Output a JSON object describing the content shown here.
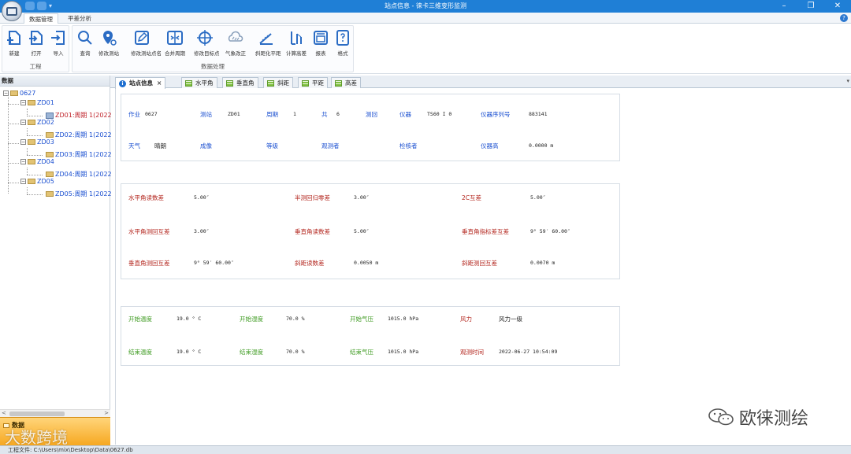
{
  "window": {
    "title": "站点信息 - 徕卡三维变形监测",
    "minimize": "–",
    "maximize": "❐",
    "close": "✕"
  },
  "ribbon_tabs": [
    "数据管理",
    "平差分析"
  ],
  "help": "?",
  "ribbon": {
    "groups": [
      {
        "label": "工程",
        "buttons": [
          "新建",
          "打开",
          "导入"
        ]
      },
      {
        "label": "数据处理",
        "buttons": [
          "查询",
          "修改测站",
          "修改测站点名",
          "合并周期",
          "修改目标点",
          "气象改正",
          "斜距化平距",
          "计算高差",
          "报表",
          "格式"
        ]
      }
    ]
  },
  "left_panel": {
    "header": "数据",
    "root": "0627",
    "stations": [
      {
        "name": "ZD01",
        "child": "ZD01:周期 1(2022"
      },
      {
        "name": "ZD02",
        "child": "ZD02:周期 1(2022"
      },
      {
        "name": "ZD03",
        "child": "ZD03:周期 1(2022"
      },
      {
        "name": "ZD04",
        "child": "ZD04:周期 1(2022"
      },
      {
        "name": "ZD05",
        "child": "ZD05:周期 1(2022"
      }
    ],
    "bottom_tab": "数据",
    "scroll_left": "<",
    "scroll_right": ">"
  },
  "doc_tabs": {
    "active": "站点信息",
    "close": "×",
    "others": [
      "水平角",
      "垂直角",
      "斜距",
      "平距",
      "高差"
    ],
    "dropdown": "▾"
  },
  "station_info": {
    "row1": [
      {
        "label": "作业",
        "value": "0627"
      },
      {
        "label": "测站",
        "value": "ZD01"
      },
      {
        "label": "周期",
        "value": "1"
      },
      {
        "label": "共",
        "value": "6"
      },
      {
        "label": "测回",
        "value": ""
      },
      {
        "label": "仪器",
        "value": "TS60 I 0"
      },
      {
        "label": "仪器序列号",
        "value": "883141"
      }
    ],
    "row2": [
      {
        "label": "天气",
        "value": "晴朗"
      },
      {
        "label": "成像",
        "value": ""
      },
      {
        "label": "等级",
        "value": ""
      },
      {
        "label": "观测者",
        "value": ""
      },
      {
        "label": "检核者",
        "value": ""
      },
      {
        "label": "仪器高",
        "value": "0.0000 m"
      }
    ]
  },
  "tolerances": [
    [
      {
        "label": "水平角读数差",
        "value": "5.00″"
      },
      {
        "label": "半测回归零差",
        "value": "3.00″"
      },
      {
        "label": "2C互差",
        "value": "5.00″"
      }
    ],
    [
      {
        "label": "水平角测回互差",
        "value": "3.00″"
      },
      {
        "label": "垂直角读数差",
        "value": "5.00″"
      },
      {
        "label": "垂直角指标差互差",
        "value": "9° 59′ 60.00″"
      }
    ],
    [
      {
        "label": "垂直角测回互差",
        "value": "9° 59′ 60.00″"
      },
      {
        "label": "斜距读数差",
        "value": "0.0050 m"
      },
      {
        "label": "斜距测回互差",
        "value": "0.0070 m"
      }
    ]
  ],
  "weather": [
    [
      {
        "label": "开始温度",
        "value": "19.0 ° C"
      },
      {
        "label": "开始湿度",
        "value": "70.0 %"
      },
      {
        "label": "开始气压",
        "value": "1015.0 hPa"
      },
      {
        "label": "风力",
        "value": "风力一级"
      }
    ],
    [
      {
        "label": "结束温度",
        "value": "19.0 ° C"
      },
      {
        "label": "结束湿度",
        "value": "70.0 %"
      },
      {
        "label": "结束气压",
        "value": "1015.0 hPa"
      },
      {
        "label": "观测时间",
        "value": "2022-06-27 10:54:09"
      }
    ]
  ],
  "status_bar": "工程文件: C:\\Users\\mix\\Desktop\\Data\\0627.db",
  "watermarks": {
    "left": "大数跨境",
    "right": "欧徕测绘"
  },
  "colors": {
    "titlebar": "#1f7fd6",
    "label_blue": "#1a4fd0",
    "label_red": "#b3261e",
    "label_green": "#3c9a1f",
    "selected_node": "#c0242b",
    "data_tab": "#f6a821"
  }
}
